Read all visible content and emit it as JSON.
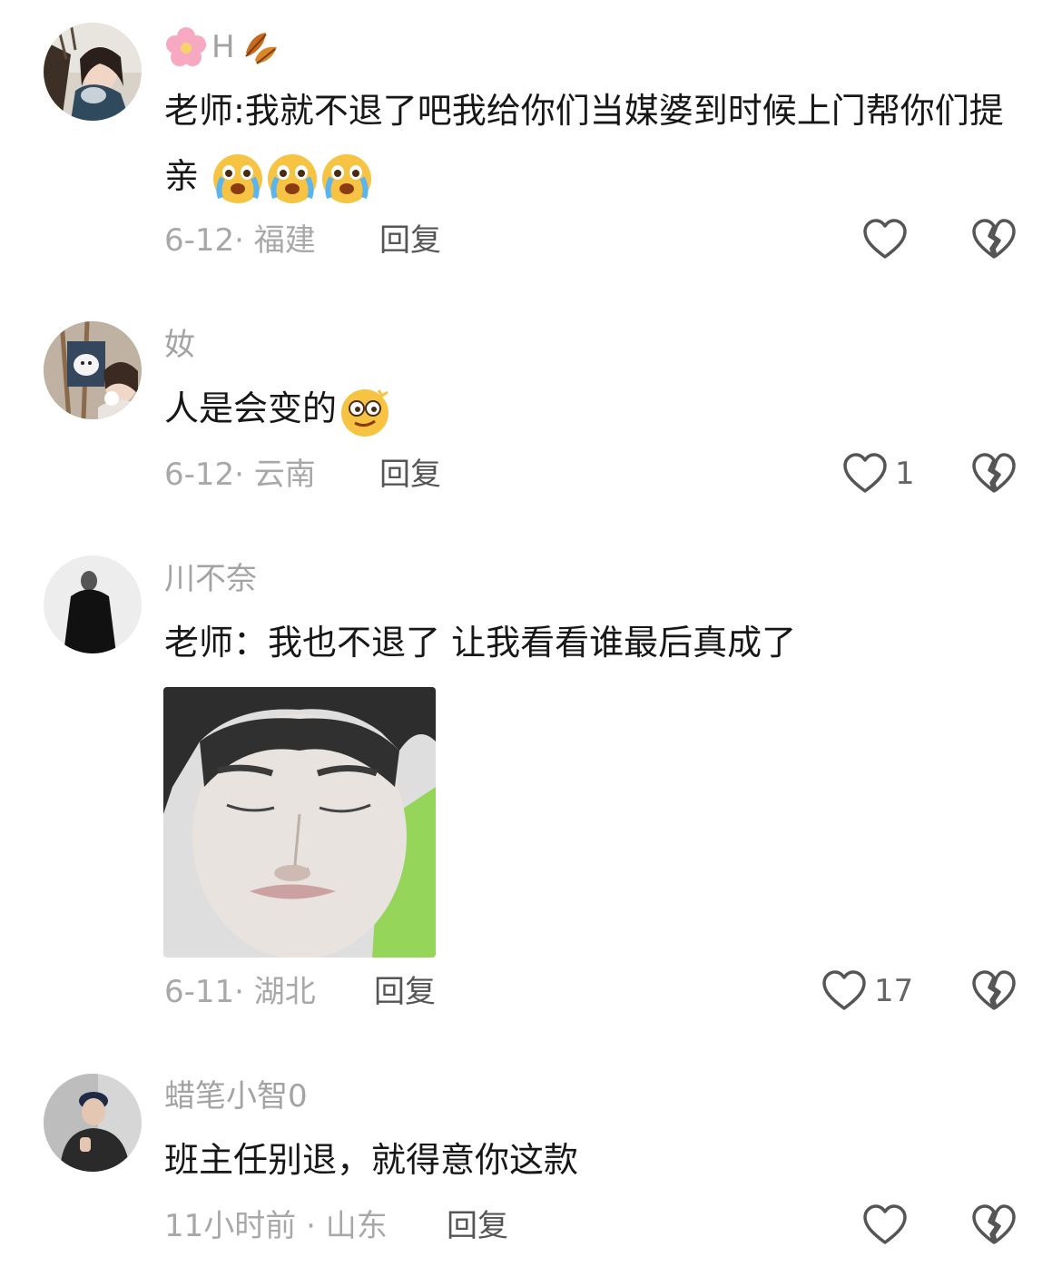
{
  "comments": [
    {
      "username": "H",
      "text": "老师:我就不退了吧我给你们当媒婆到时候上门帮你们提亲",
      "date": "6-12",
      "location": "福建",
      "reply_label": "回复",
      "likes": "",
      "emoji_count": 3
    },
    {
      "username": "奻",
      "text": "人是会变的",
      "date": "6-12",
      "location": "云南",
      "reply_label": "回复",
      "likes": "1",
      "emoji_count": 1
    },
    {
      "username": "川不奈",
      "text": "老师：我也不退了 让我看看谁最后真成了",
      "date": "6-11",
      "location": "湖北",
      "reply_label": "回复",
      "likes": "17",
      "has_image": true
    },
    {
      "username": "蜡笔小智0",
      "text": "班主任别退，就得意你这款",
      "date": "11小时前",
      "location": "山东",
      "reply_label": "回复",
      "likes": ""
    }
  ],
  "icons": {
    "like": "heart-outline-icon",
    "dislike": "broken-heart-icon",
    "cry_emoji": "crying-face-emoji",
    "dizzy_emoji": "dizzy-face-emoji"
  }
}
